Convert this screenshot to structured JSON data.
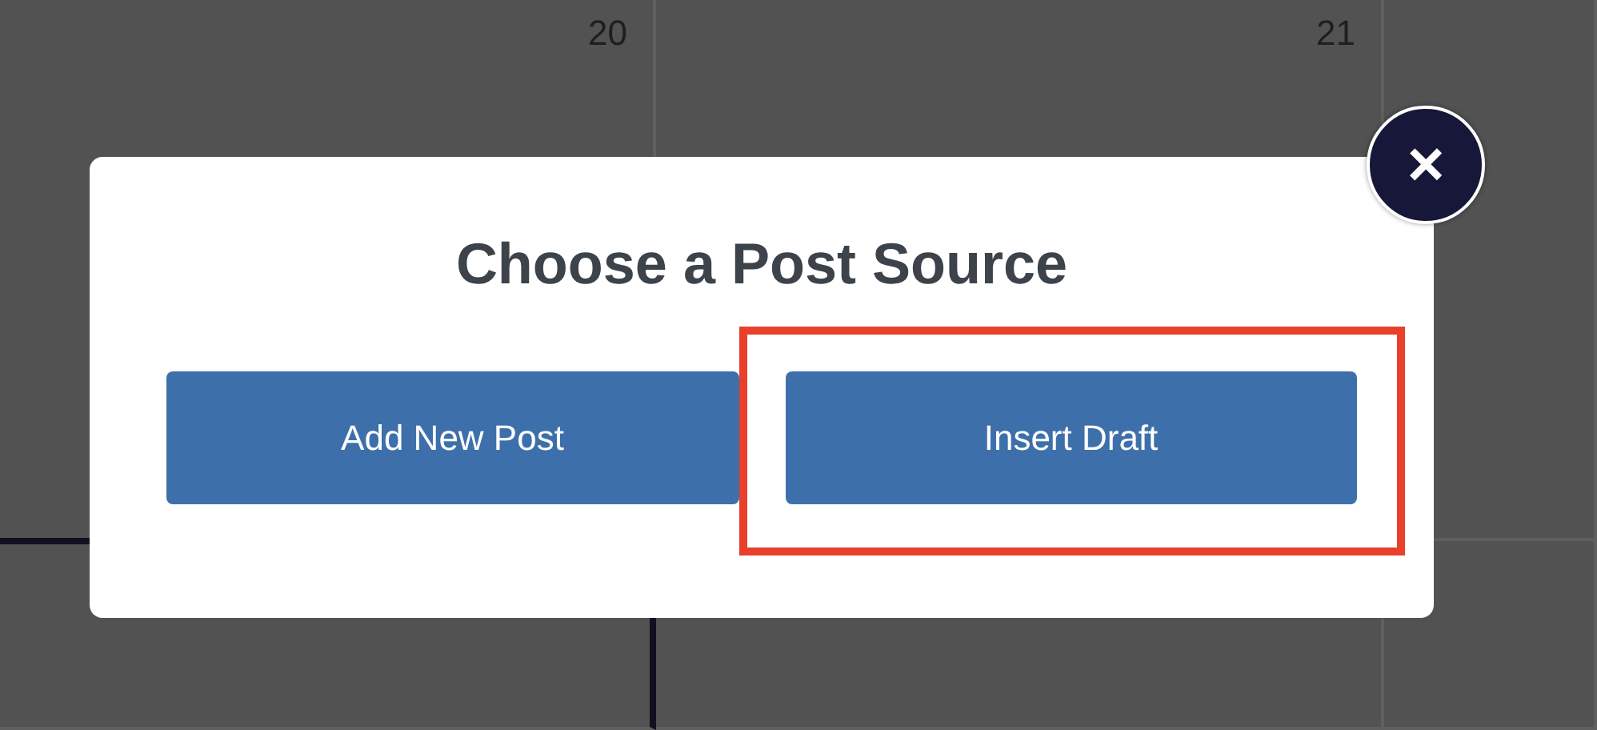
{
  "calendar": {
    "days": [
      {
        "number": "20"
      },
      {
        "number": "21"
      }
    ]
  },
  "dialog": {
    "title": "Choose a Post Source",
    "close_label": "×",
    "buttons": [
      {
        "label": "Add New Post",
        "highlighted": false
      },
      {
        "label": "Insert Draft",
        "highlighted": true
      }
    ]
  }
}
